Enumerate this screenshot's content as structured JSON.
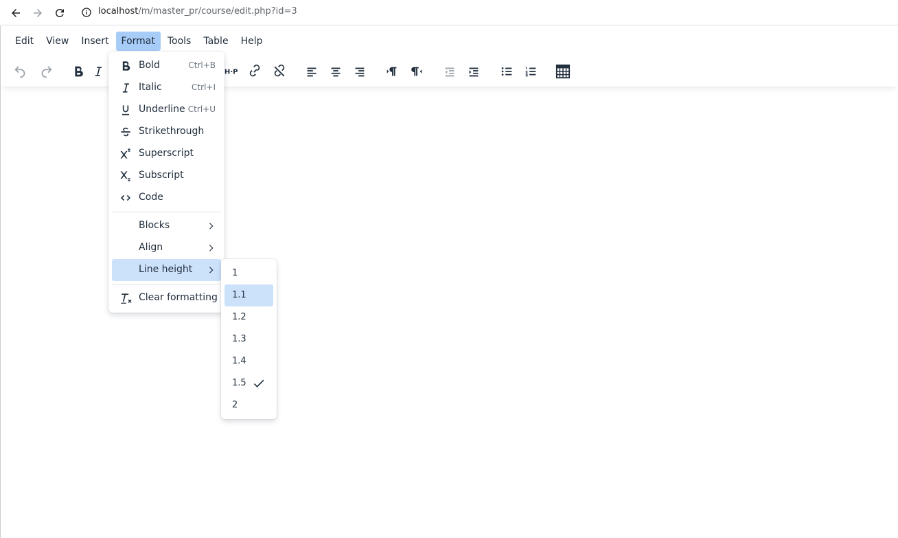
{
  "browser": {
    "url_host": "localhost",
    "url_path": "/m/master_pr/course/edit.php?id=3"
  },
  "menubar": {
    "items": [
      {
        "label": "Edit"
      },
      {
        "label": "View"
      },
      {
        "label": "Insert"
      },
      {
        "label": "Format",
        "active": true
      },
      {
        "label": "Tools"
      },
      {
        "label": "Table"
      },
      {
        "label": "Help"
      }
    ]
  },
  "toolbar": {
    "icons": [
      "undo-icon",
      "redo-icon",
      "bold-icon",
      "italic-icon",
      "h5p-icon",
      "link-icon",
      "unlink-icon",
      "align-left-icon",
      "align-center-icon",
      "align-right-icon",
      "ltr-icon",
      "rtl-icon",
      "outdent-icon",
      "indent-icon",
      "bullet-list-icon",
      "numbered-list-icon",
      "calculator-icon"
    ]
  },
  "format_menu": {
    "items": [
      {
        "label": "Bold",
        "shortcut": "Ctrl+B",
        "icon": "bold-icon"
      },
      {
        "label": "Italic",
        "shortcut": "Ctrl+I",
        "icon": "italic-icon"
      },
      {
        "label": "Underline",
        "shortcut": "Ctrl+U",
        "icon": "underline-icon"
      },
      {
        "label": "Strikethrough",
        "shortcut": "",
        "icon": "strikethrough-icon"
      },
      {
        "label": "Superscript",
        "shortcut": "",
        "icon": "superscript-icon"
      },
      {
        "label": "Subscript",
        "shortcut": "",
        "icon": "subscript-icon"
      },
      {
        "label": "Code",
        "shortcut": "",
        "icon": "code-icon"
      },
      {
        "label": "Blocks",
        "submenu": true
      },
      {
        "label": "Align",
        "submenu": true
      },
      {
        "label": "Line height",
        "submenu": true,
        "highlighted": true
      },
      {
        "label": "Clear formatting",
        "icon": "clear-formatting-icon"
      }
    ]
  },
  "line_height_menu": {
    "options": [
      {
        "label": "1"
      },
      {
        "label": "1.1",
        "highlighted": true
      },
      {
        "label": "1.2"
      },
      {
        "label": "1.3"
      },
      {
        "label": "1.4"
      },
      {
        "label": "1.5",
        "selected": true
      },
      {
        "label": "2"
      }
    ]
  },
  "colors": {
    "text": "#222f3e",
    "active_menu": "#a6ccf7",
    "highlight": "#cce2fa"
  }
}
